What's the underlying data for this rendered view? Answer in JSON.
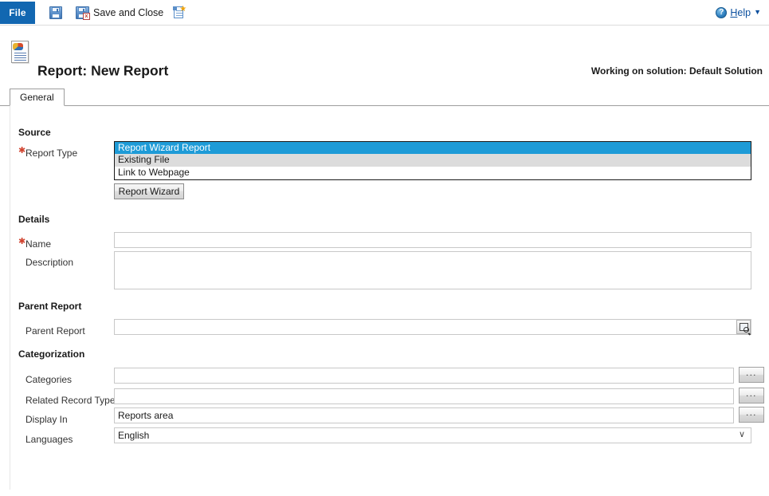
{
  "commandbar": {
    "file_label": "File",
    "save_label": "",
    "save_and_close_label": "Save and Close",
    "new_label": "",
    "help_label_prefix": "H",
    "help_label_rest": "elp",
    "help_icon_glyph": "?"
  },
  "header": {
    "title": "Report: New Report",
    "solution_note": "Working on solution: Default Solution"
  },
  "tabs": [
    {
      "label": "General"
    }
  ],
  "sections": {
    "source": {
      "title": "Source",
      "report_type_label": "Report Type",
      "report_type_options": [
        "Report Wizard Report",
        "Existing File",
        "Link to Webpage"
      ],
      "report_type_selected": "Report Wizard Report",
      "report_wizard_button": "Report Wizard"
    },
    "details": {
      "title": "Details",
      "name_label": "Name",
      "name_value": "",
      "description_label": "Description",
      "description_value": ""
    },
    "parent_report": {
      "title": "Parent Report",
      "field_label": "Parent Report",
      "value": ""
    },
    "categorization": {
      "title": "Categorization",
      "rows": [
        {
          "label": "Categories",
          "value": "",
          "button": "..."
        },
        {
          "label": "Related Record Types",
          "value": "",
          "button": "..."
        },
        {
          "label": "Display In",
          "value": "Reports area",
          "button": "..."
        }
      ],
      "languages_label": "Languages",
      "languages_value": "English",
      "languages_chevron": "∨"
    }
  }
}
